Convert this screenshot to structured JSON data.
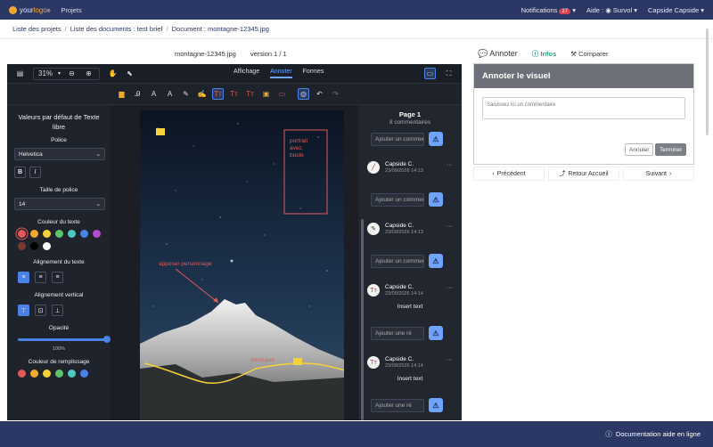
{
  "topbar": {
    "logo_prefix": "your",
    "logo_suffix": "logo",
    "logo_reg": "®",
    "projects": "Projets",
    "notifications": "Notifications",
    "notif_count": "27",
    "aide": "Aide :",
    "survol": "Survol",
    "user": "Capside Capside"
  },
  "breadcrumb": {
    "items": [
      "Liste des projets",
      "Liste des documents : test brief",
      "Document : montagne-12345.jpg"
    ],
    "sep": "/"
  },
  "doc": {
    "filename": "montagne-12345.jpg",
    "version": "version 1 / 1"
  },
  "editor_toolbar": {
    "zoom": "31%",
    "tabs": [
      "Affichage",
      "Annoter",
      "Formes"
    ],
    "active_tab": "Annoter",
    "tool_icons": [
      "highlight-icon",
      "text-small-icon",
      "text-medium-icon",
      "text-large-icon",
      "pen-icon",
      "signature-icon",
      "text-box-icon",
      "text-strike-icon",
      "text-replace-icon",
      "comment-icon",
      "redact-icon",
      "palette-icon",
      "undo-icon",
      "redo-icon"
    ]
  },
  "left_panel": {
    "title": "Valeurs par défaut de Texte libre",
    "font_label": "Police",
    "font_value": "Helvetica",
    "bold": "B",
    "italic": "I",
    "size_label": "Taille de police",
    "size_value": "14",
    "text_color_label": "Couleur du texte",
    "text_colors": [
      "#e05a5a",
      "#f0a830",
      "#f5d23a",
      "#5cc469",
      "#4cc9c0",
      "#4a82e8",
      "#b44bd1",
      "#7a3b2e",
      "#000000",
      "#ffffff"
    ],
    "align_label": "Alignement du texte",
    "valign_label": "Alignement vertical",
    "opacity_label": "Opacité",
    "opacity_value": "100%",
    "opacity_level": 1.0,
    "fill_color_label": "Couleur de remplissage",
    "fill_colors": [
      "#e05a5a",
      "#f0a830",
      "#f5d23a",
      "#5cc469",
      "#4cc9c0",
      "#4a82e8"
    ]
  },
  "canvas": {
    "annotation_portrait": "portrait\navec\nbuste",
    "annotation_personnage": "apposer personnage",
    "annotation_decouper": "découper"
  },
  "comments_panel": {
    "page_title": "Page 1",
    "count": "8 commentaires",
    "placeholder": "Ajouter un commentaire",
    "placeholder_short": "Ajouter une ré",
    "comments": [
      {
        "author": "Capside C.",
        "date": "23/09/2026 14:13",
        "text": ""
      },
      {
        "author": "Capside C.",
        "date": "23/09/2026 14:13",
        "text": ""
      },
      {
        "author": "Capside C.",
        "date": "23/09/2026 14:14",
        "text": "Insert text"
      },
      {
        "author": "Capside C.",
        "date": "23/09/2026 14:14",
        "text": "Insert text"
      }
    ]
  },
  "side": {
    "tab_annoter": "Annoter",
    "tab_infos": "Infos",
    "tab_comparer": "Comparer",
    "panel_title": "Annoter le visuel",
    "textarea_placeholder": "Saisissez ici un commentaire",
    "btn_cancel": "Annuler",
    "btn_finish": "Terminer",
    "nav_prev": "Précédent",
    "nav_home": "Retour Accueil",
    "nav_next": "Suivant"
  },
  "footer": {
    "help": "Documentation aide en ligne"
  }
}
